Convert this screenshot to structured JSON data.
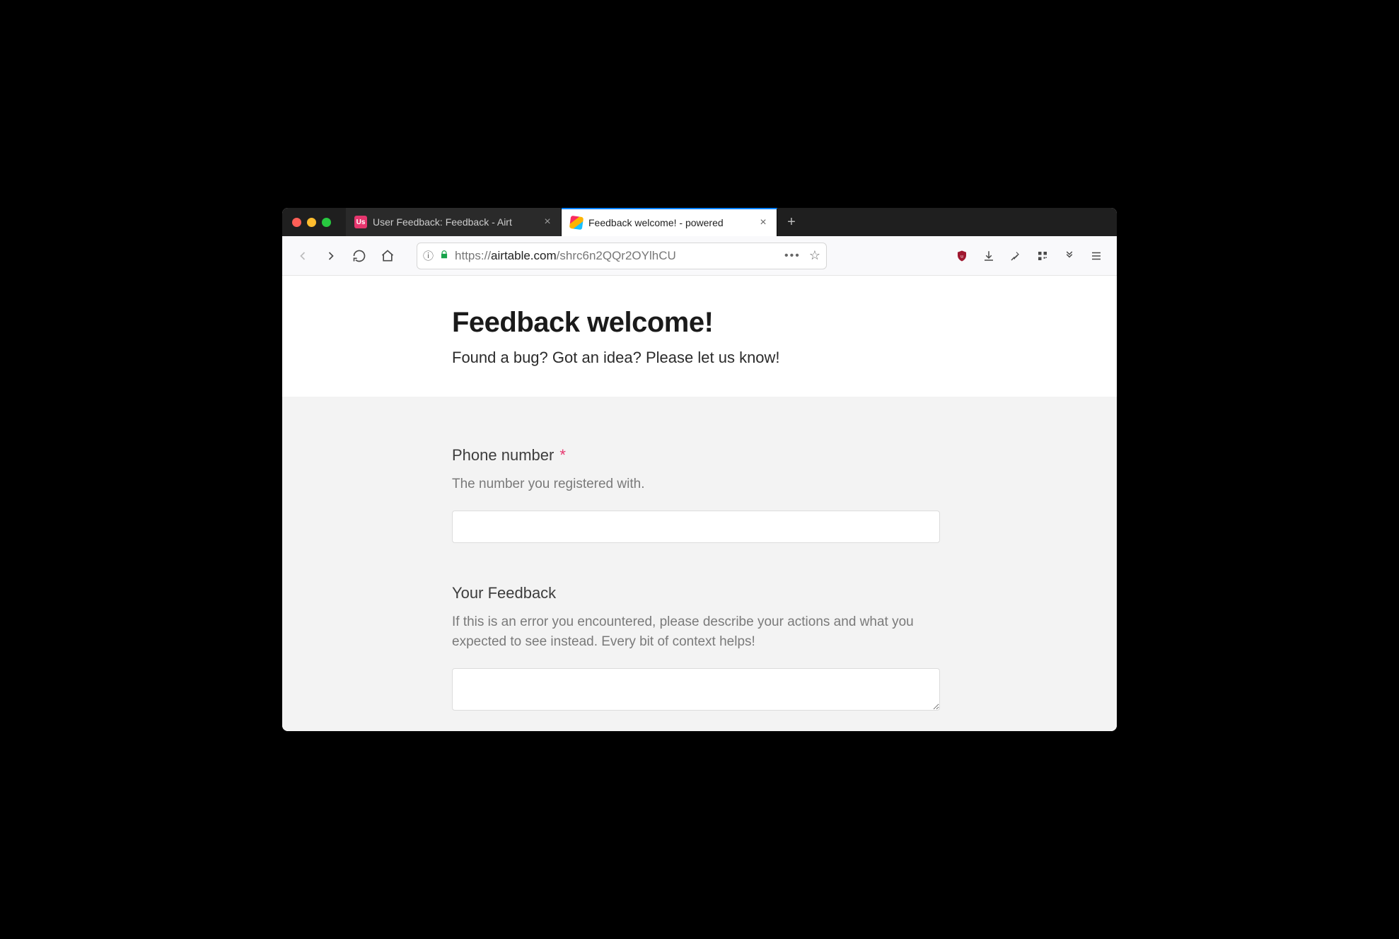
{
  "browser": {
    "tabs": [
      {
        "title": "User Feedback: Feedback - Airt",
        "favicon_text": "Us",
        "active": false
      },
      {
        "title": "Feedback welcome! - powered",
        "favicon_text": "",
        "active": true
      }
    ],
    "url_display_prefix": "https://",
    "url_display_host": "airtable.com",
    "url_display_path": "/shrc6n2QQr2OYlhCU"
  },
  "form": {
    "title": "Feedback welcome!",
    "subtitle": "Found a bug? Got an idea? Please let us know!",
    "fields": {
      "phone": {
        "label": "Phone number",
        "required_mark": "*",
        "help": "The number you registered with.",
        "value": ""
      },
      "feedback": {
        "label": "Your Feedback",
        "help": "If this is an error you encountered, please describe your actions and what you expected to see instead. Every bit of context helps!",
        "value": ""
      }
    }
  },
  "icons": {
    "newtab_label": "+",
    "close_label": "×"
  }
}
